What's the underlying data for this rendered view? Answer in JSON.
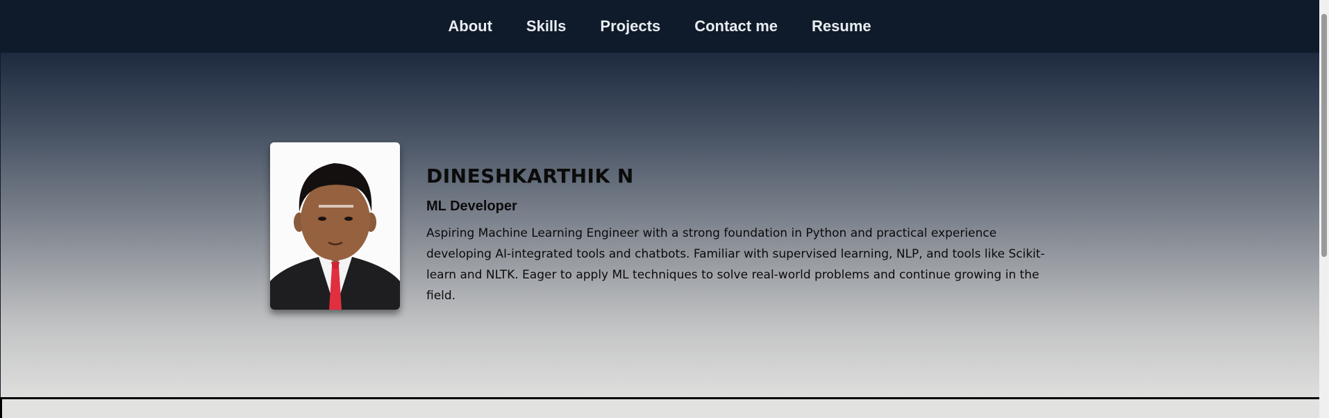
{
  "nav": {
    "items": [
      {
        "label": "About"
      },
      {
        "label": "Skills"
      },
      {
        "label": "Projects"
      },
      {
        "label": "Contact me"
      },
      {
        "label": "Resume"
      }
    ]
  },
  "hero": {
    "name": "DINESHKARTHIK N",
    "role": "ML Developer",
    "bio": "Aspiring Machine Learning Engineer with a strong foundation in Python and practical experience developing AI-integrated tools and chatbots. Familiar with supervised learning, NLP, and tools like Scikit-learn and NLTK. Eager to apply ML techniques to solve real-world problems and continue growing in the field.",
    "photo_icon": "profile-photo"
  },
  "colors": {
    "nav_bg": "#0f1b2b",
    "nav_text": "#e9edf2",
    "hero_gradient_top": "#1d2a3f",
    "hero_gradient_bottom": "#dededd",
    "text_dark": "#0b0b0b"
  }
}
